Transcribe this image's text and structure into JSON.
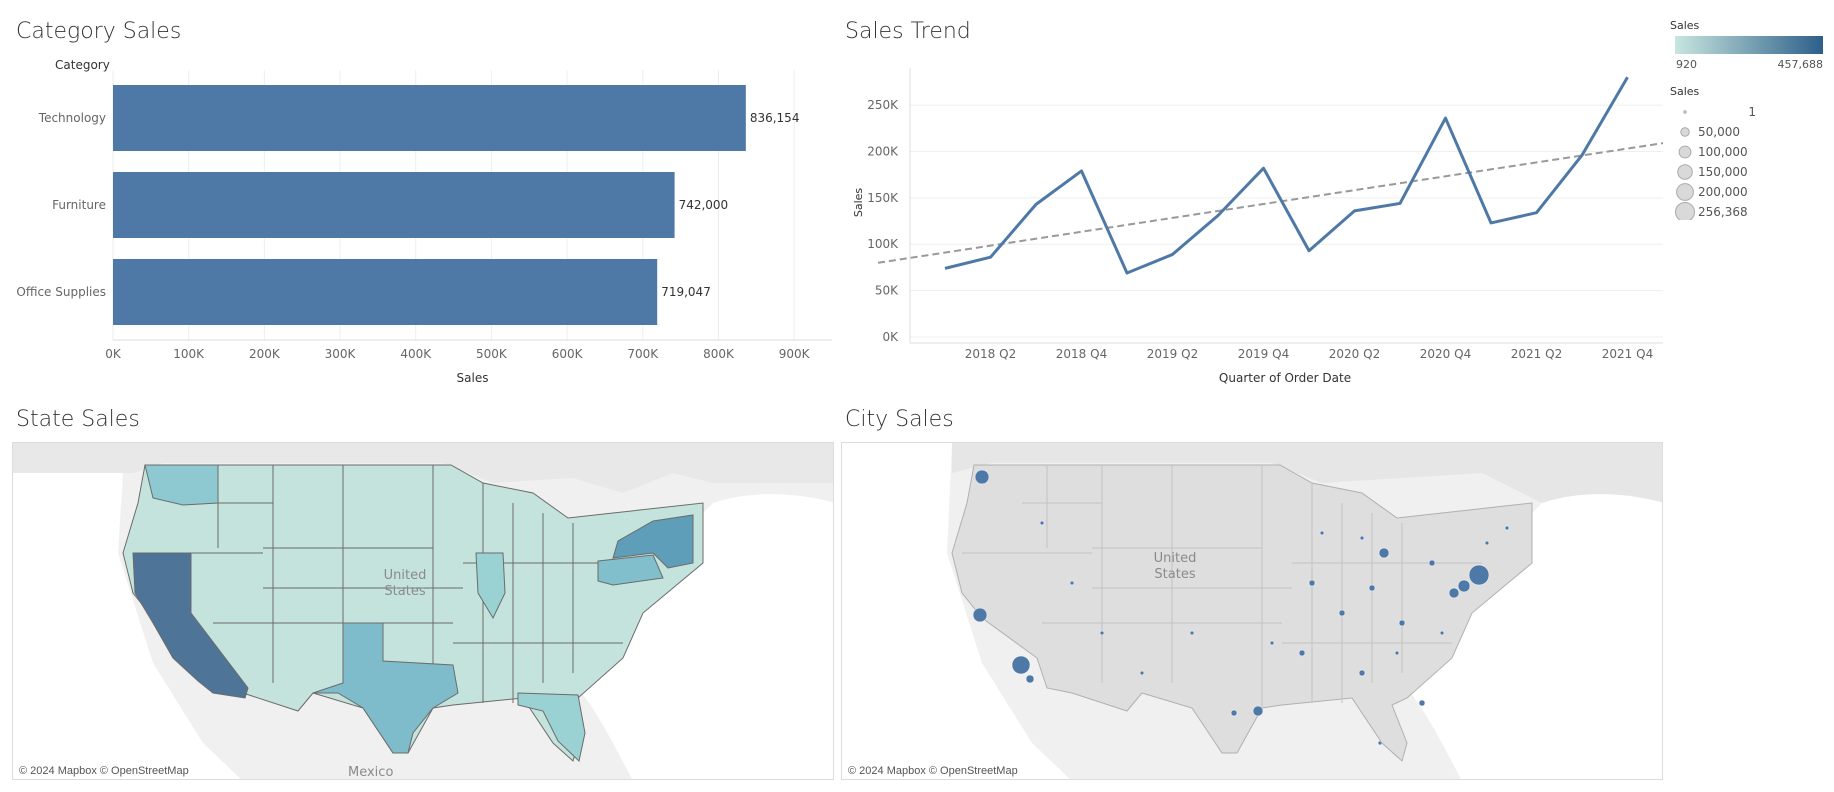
{
  "titles": {
    "category_sales": "Category Sales",
    "sales_trend": "Sales Trend",
    "state_sales": "State Sales",
    "city_sales": "City Sales"
  },
  "legend_color": {
    "title": "Sales",
    "min": "920",
    "max": "457,688",
    "from": "#c8e6df",
    "to": "#2d5f8a"
  },
  "legend_size": {
    "title": "Sales",
    "items": [
      {
        "label": "1",
        "value": 1
      },
      {
        "label": "50,000",
        "value": 50000
      },
      {
        "label": "100,000",
        "value": 100000
      },
      {
        "label": "150,000",
        "value": 150000
      },
      {
        "label": "200,000",
        "value": 200000
      },
      {
        "label": "256,368",
        "value": 256368
      }
    ]
  },
  "maps": {
    "state": {
      "credit": "© 2024 Mapbox © OpenStreetMap",
      "label_country": "United States",
      "label_mexico": "Mexico"
    },
    "city": {
      "credit": "© 2024 Mapbox © OpenStreetMap",
      "label_country": "United States"
    }
  },
  "chart_data": [
    {
      "type": "bar",
      "orientation": "horizontal",
      "title": "Category Sales",
      "row_header": "Category",
      "xlabel": "Sales",
      "categories": [
        "Technology",
        "Furniture",
        "Office Supplies"
      ],
      "values": [
        836154,
        742000,
        719047
      ],
      "value_labels": [
        "836,154",
        "742,000",
        "719,047"
      ],
      "xlim": [
        0,
        950000
      ],
      "xticks": [
        0,
        100000,
        200000,
        300000,
        400000,
        500000,
        600000,
        700000,
        800000,
        900000
      ],
      "xtick_labels": [
        "0K",
        "100K",
        "200K",
        "300K",
        "400K",
        "500K",
        "600K",
        "700K",
        "800K",
        "900K"
      ],
      "color": "#4e79a7"
    },
    {
      "type": "line",
      "title": "Sales Trend",
      "xlabel": "Quarter of Order Date",
      "ylabel": "Sales",
      "quarters": [
        "2018 Q1",
        "2018 Q2",
        "2018 Q3",
        "2018 Q4",
        "2019 Q1",
        "2019 Q2",
        "2019 Q3",
        "2019 Q4",
        "2020 Q1",
        "2020 Q2",
        "2020 Q3",
        "2020 Q4",
        "2021 Q1",
        "2021 Q2",
        "2021 Q3",
        "2021 Q4"
      ],
      "values": [
        74000,
        86000,
        143000,
        179000,
        69000,
        89000,
        131000,
        182000,
        93000,
        136000,
        144000,
        236000,
        123000,
        134000,
        196000,
        280000
      ],
      "xtick_labels": [
        "2018 Q2",
        "2018 Q4",
        "2019 Q2",
        "2019 Q4",
        "2020 Q2",
        "2020 Q4",
        "2021 Q2",
        "2021 Q4"
      ],
      "yticks": [
        0,
        50000,
        100000,
        150000,
        200000,
        250000
      ],
      "ytick_labels": [
        "0K",
        "50K",
        "100K",
        "150K",
        "200K",
        "250K"
      ],
      "ylim": [
        0,
        290000
      ],
      "trend_line": {
        "start": 80000,
        "end": 209000
      },
      "color": "#4e79a7",
      "trend_color": "#999999"
    }
  ]
}
